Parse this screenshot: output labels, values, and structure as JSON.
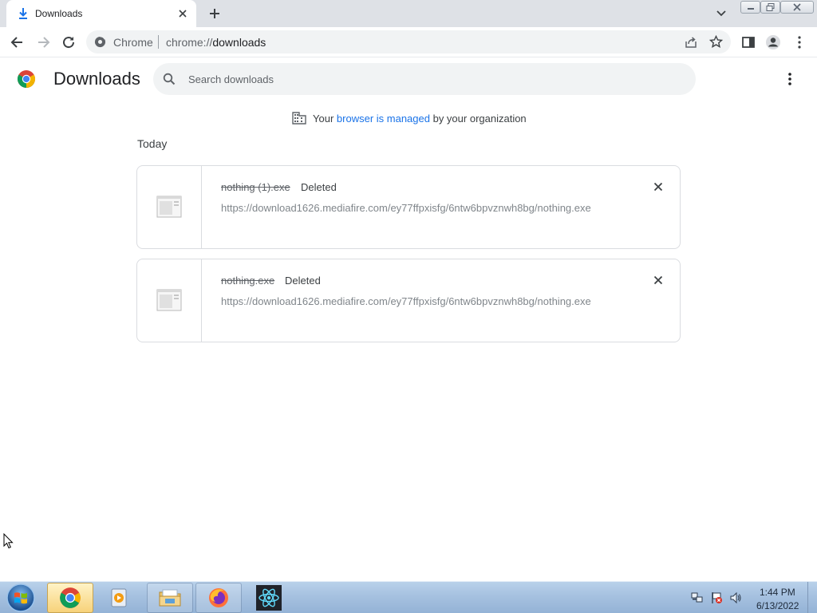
{
  "window": {
    "tab_title": "Downloads",
    "controls": {
      "minimize": "minimize",
      "maximize": "maximize",
      "close": "close"
    }
  },
  "toolbar": {
    "chip_label": "Chrome",
    "url_scheme": "chrome://",
    "url_host": "downloads"
  },
  "page": {
    "title": "Downloads",
    "search_placeholder": "Search downloads",
    "managed_prefix": "Your",
    "managed_link": "browser is managed",
    "managed_suffix": "by your organization",
    "section_label": "Today"
  },
  "downloads": [
    {
      "file_name": "nothing (1).exe",
      "status": "Deleted",
      "url": "https://download1626.mediafire.com/ey77ffpxisfg/6ntw6bpvznwh8bg/nothing.exe"
    },
    {
      "file_name": "nothing.exe",
      "status": "Deleted",
      "url": "https://download1626.mediafire.com/ey77ffpxisfg/6ntw6bpvznwh8bg/nothing.exe"
    }
  ],
  "taskbar": {
    "items": [
      "chrome-icon",
      "media-player-icon",
      "file-explorer-icon",
      "firefox-icon",
      "react-app-icon"
    ],
    "clock_time": "1:44 PM",
    "clock_date": "6/13/2022"
  },
  "colors": {
    "link": "#1a73e8",
    "tabstrip": "#dee1e6",
    "omnibox": "#f1f3f4",
    "card_border": "#dadce0"
  }
}
